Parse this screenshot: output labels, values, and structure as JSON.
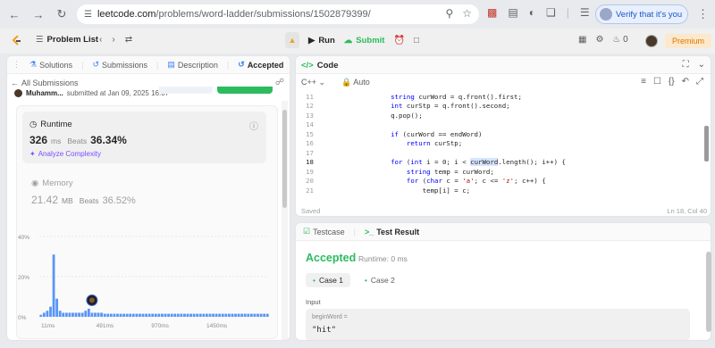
{
  "browser": {
    "url_host": "leetcode.com",
    "url_path": "/problems/word-ladder/submissions/1502879399/",
    "verify_label": "Verify that it's you"
  },
  "nav": {
    "problem_list": "Problem List",
    "run": "Run",
    "submit": "Submit",
    "fire_count": "0",
    "premium": "Premium"
  },
  "left_tabs": [
    {
      "label": "Solutions",
      "icon": "flask-icon"
    },
    {
      "label": "Submissions",
      "icon": "history-icon"
    },
    {
      "label": "Description",
      "icon": "doc-icon"
    },
    {
      "label": "Accepted",
      "icon": "history-icon"
    }
  ],
  "submission": {
    "back_label": "All Submissions",
    "author": "Muhamm...",
    "submitted": "submitted at Jan 09, 2025 16:07"
  },
  "runtime": {
    "label": "Runtime",
    "value": "326",
    "unit": "ms",
    "beats_label": "Beats",
    "beats": "36.34%",
    "analyze": "Analyze Complexity"
  },
  "memory": {
    "label": "Memory",
    "value": "21.42",
    "unit": "MB",
    "beats_label": "Beats",
    "beats": "36.52%"
  },
  "chart_data": {
    "type": "bar",
    "y_ticks": [
      "40%",
      "20%",
      "0%"
    ],
    "ylim": [
      0,
      40
    ],
    "x_ticks": [
      "11ms",
      "491ms",
      "970ms",
      "1450ms"
    ],
    "values": [
      1,
      2,
      3,
      5,
      31,
      9,
      3,
      2,
      2,
      2,
      2,
      2,
      2,
      2,
      3,
      4,
      2,
      2,
      2,
      2,
      1.5,
      1.5,
      1.5,
      1.5,
      1.5,
      1.5,
      1.5,
      1.5,
      1.5,
      1.5,
      1.5,
      1.5,
      1.5,
      1.5,
      1.5,
      1.5,
      1.5,
      1.5,
      1.5,
      1.5,
      1.5,
      1.5,
      1.5,
      1.5,
      1.5,
      1.5,
      1.5,
      1.5,
      1.5,
      1.5,
      1.5,
      1.5,
      1.5,
      1.5,
      1.5,
      1.5,
      1.5,
      1.5,
      1.5,
      1.5,
      1.5,
      1.5,
      1.5,
      1.5,
      1.5,
      1.5,
      1.5,
      1.5,
      1.5,
      1.5,
      1.5,
      1.5
    ],
    "marker_index": 16,
    "bar_color": "#3b82f6",
    "grid": true
  },
  "editor": {
    "title": "Code",
    "language": "C++",
    "auto": "Auto",
    "saved": "Saved",
    "position": "Ln 18, Col 40",
    "lines": [
      {
        "n": "11",
        "pre": "        ",
        "parts": [
          {
            "t": "string",
            "c": "ty"
          },
          {
            "t": " curWord = q.front().first;",
            "c": ""
          }
        ]
      },
      {
        "n": "12",
        "pre": "        ",
        "parts": [
          {
            "t": "int",
            "c": "ty"
          },
          {
            "t": " curStp = q.front().second;",
            "c": ""
          }
        ]
      },
      {
        "n": "13",
        "pre": "        ",
        "parts": [
          {
            "t": "q.pop();",
            "c": ""
          }
        ]
      },
      {
        "n": "14",
        "pre": "",
        "parts": []
      },
      {
        "n": "15",
        "pre": "        ",
        "parts": [
          {
            "t": "if",
            "c": "kw"
          },
          {
            "t": " (curWord == endWord)",
            "c": ""
          }
        ]
      },
      {
        "n": "16",
        "pre": "            ",
        "parts": [
          {
            "t": "return",
            "c": "kw"
          },
          {
            "t": " curStp;",
            "c": ""
          }
        ]
      },
      {
        "n": "17",
        "pre": "",
        "parts": []
      },
      {
        "n": "18",
        "pre": "        ",
        "parts": [
          {
            "t": "for",
            "c": "kw"
          },
          {
            "t": " (",
            "c": ""
          },
          {
            "t": "int",
            "c": "ty"
          },
          {
            "t": " i = 0; i < ",
            "c": ""
          },
          {
            "t": "curWord",
            "c": "hl"
          },
          {
            "t": ".length(); i++) {",
            "c": ""
          }
        ]
      },
      {
        "n": "19",
        "pre": "            ",
        "parts": [
          {
            "t": "string",
            "c": "ty"
          },
          {
            "t": " temp = curWord;",
            "c": ""
          }
        ]
      },
      {
        "n": "20",
        "pre": "            ",
        "parts": [
          {
            "t": "for",
            "c": "kw"
          },
          {
            "t": " (",
            "c": ""
          },
          {
            "t": "char",
            "c": "ty"
          },
          {
            "t": " c = ",
            "c": ""
          },
          {
            "t": "'a'",
            "c": "st"
          },
          {
            "t": "; c <= ",
            "c": ""
          },
          {
            "t": "'z'",
            "c": "st"
          },
          {
            "t": "; c++) {",
            "c": ""
          }
        ]
      },
      {
        "n": "21",
        "pre": "                ",
        "parts": [
          {
            "t": "temp[i] = c;",
            "c": ""
          }
        ]
      }
    ]
  },
  "test": {
    "tab_testcase": "Testcase",
    "tab_result": "Test Result",
    "status": "Accepted",
    "runtime": "Runtime: 0 ms",
    "case1": "Case 1",
    "case2": "Case 2",
    "input_label": "Input",
    "var_name": "beginWord =",
    "var_value": "\"hit\""
  }
}
